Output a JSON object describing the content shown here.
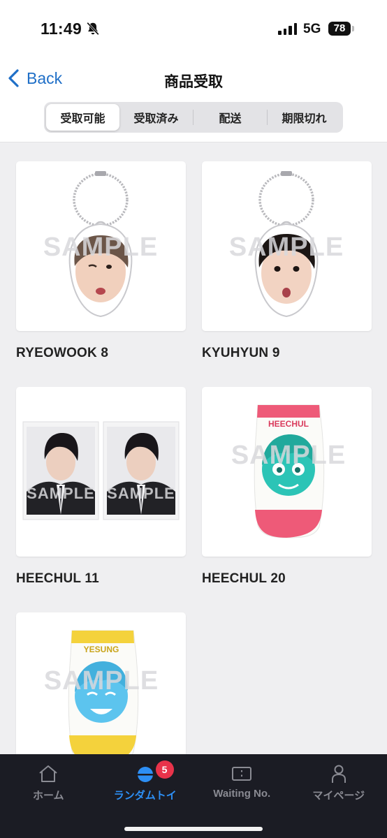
{
  "status_bar": {
    "time": "11:49",
    "network": "5G",
    "battery": "78"
  },
  "nav": {
    "back_label": "Back",
    "title": "商品受取"
  },
  "segments": [
    {
      "label": "受取可能",
      "active": true
    },
    {
      "label": "受取済み",
      "active": false
    },
    {
      "label": "配送",
      "active": false
    },
    {
      "label": "期限切れ",
      "active": false
    }
  ],
  "watermark": "SAMPLE",
  "items": [
    {
      "name": "RYEOWOOK 8",
      "type": "keychain"
    },
    {
      "name": "KYUHYUN 9",
      "type": "keychain"
    },
    {
      "name": "HEECHUL 11",
      "type": "photo"
    },
    {
      "name": "HEECHUL 20",
      "type": "sock",
      "sock_text": "HEECHUL"
    },
    {
      "name": "",
      "type": "sock",
      "sock_text": "YESUNG"
    }
  ],
  "tabs": [
    {
      "label": "ホーム",
      "icon": "home-icon",
      "active": false
    },
    {
      "label": "ランダムトイ",
      "icon": "capsule-icon",
      "active": true,
      "badge": "5"
    },
    {
      "label": "Waiting No.",
      "icon": "ticket-icon",
      "active": false
    },
    {
      "label": "マイページ",
      "icon": "person-icon",
      "active": false
    }
  ],
  "colors": {
    "accent": "#2d8ff5",
    "back_link": "#1f6fc7",
    "badge": "#e8334a",
    "tabbar_bg": "#1b1c24",
    "heechul_sock_print": "#2cc4b6",
    "heechul_sock_trim": "#ee5a78",
    "yesung_sock_print": "#5cc4ee",
    "yesung_sock_trim": "#f4d23c"
  }
}
